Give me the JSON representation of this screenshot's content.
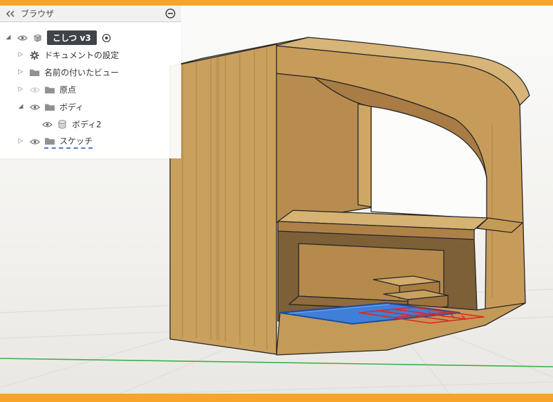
{
  "frame": {
    "accent_color": "#F7A428"
  },
  "glyphs": {
    "expanded": "◢",
    "collapsed": "▷"
  },
  "browser_panel": {
    "header": {
      "title": "ブラウザ",
      "collapse_icon": "double-left-chevron-icon",
      "minimize_icon": "circled-minus-icon"
    },
    "tree": [
      {
        "label": "こしつ v3",
        "icon": "component-cube-icon",
        "expander": "expanded",
        "eye": "visible",
        "selected": true,
        "trailing_icon": "active-component-radio-icon"
      },
      {
        "label": "ドキュメントの設定",
        "icon": "gear-icon",
        "expander": "collapsed"
      },
      {
        "label": "名前の付いたビュー",
        "icon": "folder-icon",
        "expander": "collapsed"
      },
      {
        "label": "原点",
        "icon": "folder-icon",
        "expander": "collapsed",
        "eye": "hidden"
      },
      {
        "label": "ボディ",
        "icon": "folder-icon",
        "expander": "expanded",
        "eye": "visible",
        "children": [
          {
            "label": "ボディ2",
            "icon": "body-cylinder-icon",
            "eye": "visible"
          }
        ]
      },
      {
        "label": "スケッチ",
        "icon": "sketch-folder-icon",
        "expander": "collapsed",
        "eye": "visible",
        "style": "dashed-blue-underline"
      }
    ]
  },
  "viewport": {
    "ground_axis_color": "#3FAE49",
    "grid_color": "#DCDBD8",
    "selected_plane_color": "#3F7FD9",
    "sketch_profile_color": "#E0241F",
    "model_wood_colors": {
      "light": "#D7B478",
      "mid": "#C79C5A",
      "inner": "#B78C4E",
      "dark": "#8F6B3D"
    }
  }
}
